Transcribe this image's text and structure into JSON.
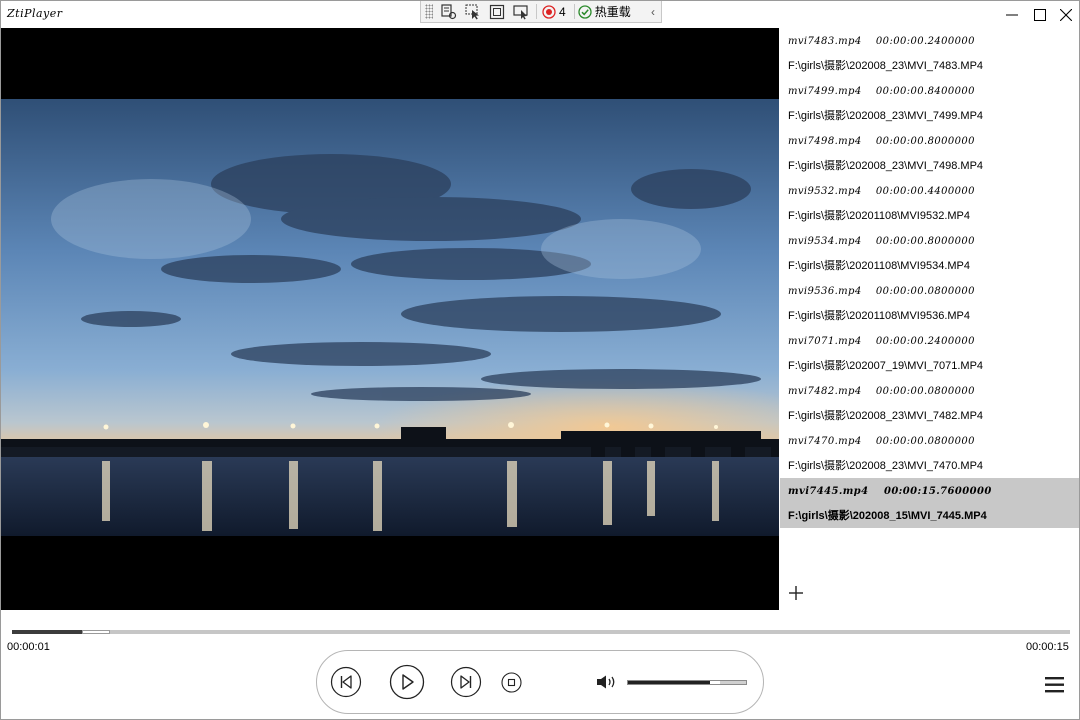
{
  "app": {
    "title": "ZtiPlayer"
  },
  "devbar": {
    "record_count": "4",
    "reload_label": "热重载"
  },
  "window_controls": [
    "minimize",
    "maximize",
    "close"
  ],
  "playlist": {
    "items": [
      {
        "name": "mvi7483.mp4    00:00:00.2400000",
        "path": "F:\\girls\\摄影\\202008_23\\MVI_7483.MP4",
        "selected": false
      },
      {
        "name": "mvi7499.mp4    00:00:00.8400000",
        "path": "F:\\girls\\摄影\\202008_23\\MVI_7499.MP4",
        "selected": false
      },
      {
        "name": "mvi7498.mp4    00:00:00.8000000",
        "path": "F:\\girls\\摄影\\202008_23\\MVI_7498.MP4",
        "selected": false
      },
      {
        "name": "mvi9532.mp4    00:00:00.4400000",
        "path": "F:\\girls\\摄影\\20201108\\MVI9532.MP4",
        "selected": false
      },
      {
        "name": "mvi9534.mp4    00:00:00.8000000",
        "path": "F:\\girls\\摄影\\20201108\\MVI9534.MP4",
        "selected": false
      },
      {
        "name": "mvi9536.mp4    00:00:00.0800000",
        "path": "F:\\girls\\摄影\\20201108\\MVI9536.MP4",
        "selected": false
      },
      {
        "name": "mvi7071.mp4    00:00:00.2400000",
        "path": "F:\\girls\\摄影\\202007_19\\MVI_7071.MP4",
        "selected": false
      },
      {
        "name": "mvi7482.mp4    00:00:00.0800000",
        "path": "F:\\girls\\摄影\\202008_23\\MVI_7482.MP4",
        "selected": false
      },
      {
        "name": "mvi7470.mp4    00:00:00.0800000",
        "path": "F:\\girls\\摄影\\202008_23\\MVI_7470.MP4",
        "selected": false
      },
      {
        "name": "mvi7445.mp4    00:00:15.7600000",
        "path": "F:\\girls\\摄影\\202008_15\\MVI_7445.MP4",
        "selected": true
      }
    ],
    "add_icon": "plus-icon"
  },
  "playback": {
    "current_time": "00:00:01",
    "total_time": "00:00:15",
    "progress": 0.066,
    "buffered_start": 0.066,
    "buffered_end": 0.093,
    "volume": 0.73
  },
  "controls": [
    "previous-icon",
    "play-icon",
    "next-icon",
    "stop-icon",
    "volume-icon",
    "menu-icon"
  ],
  "colors": {
    "selected_row": "#c8c8c8",
    "video_bg": "#000000",
    "progress_fill": "#3c3c3c",
    "progress_track": "#c6c6c6"
  }
}
